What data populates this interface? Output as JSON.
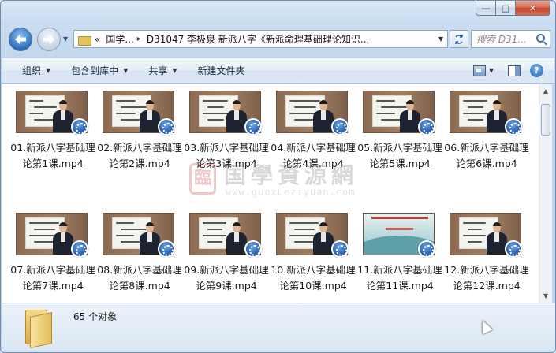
{
  "window": {
    "buttons": {
      "minimize": "—",
      "maximize": "□",
      "close": "✕"
    }
  },
  "address_bar": {
    "prefix": "«",
    "crumbs": [
      "国学...",
      "D31047 李极泉 新派八字《新派命理基础理论知识..."
    ],
    "separator": "▸"
  },
  "search": {
    "placeholder": "搜索 D31..."
  },
  "toolbar": {
    "organize": "组织",
    "include_in_library": "包含到库中",
    "share": "共享",
    "new_folder": "新建文件夹"
  },
  "files": [
    {
      "name": "01.新派八字基础理论第1课.mp4"
    },
    {
      "name": "02.新派八字基础理论第2课.mp4"
    },
    {
      "name": "03.新派八字基础理论第3课.mp4"
    },
    {
      "name": "04.新派八字基础理论第4课.mp4"
    },
    {
      "name": "05.新派八字基础理论第5课.mp4"
    },
    {
      "name": "06.新派八字基础理论第6课.mp4"
    },
    {
      "name": "07.新派八字基础理论第7课.mp4"
    },
    {
      "name": "08.新派八字基础理论第8课.mp4"
    },
    {
      "name": "09.新派八字基础理论第9课.mp4"
    },
    {
      "name": "10.新派八字基础理论第10课.mp4"
    },
    {
      "name": "11.新派八字基础理论第11课.mp4"
    },
    {
      "name": "12.新派八字基础理论第12课.mp4"
    }
  ],
  "watermark": {
    "seal": "臨",
    "title": "国學資源網",
    "url": "www.guoxueziyuan.com"
  },
  "status": {
    "item_count": "65 个对象"
  },
  "colors": {
    "accent": "#1d56a8",
    "frame": "#c9dcf0",
    "close": "#c0442a"
  }
}
